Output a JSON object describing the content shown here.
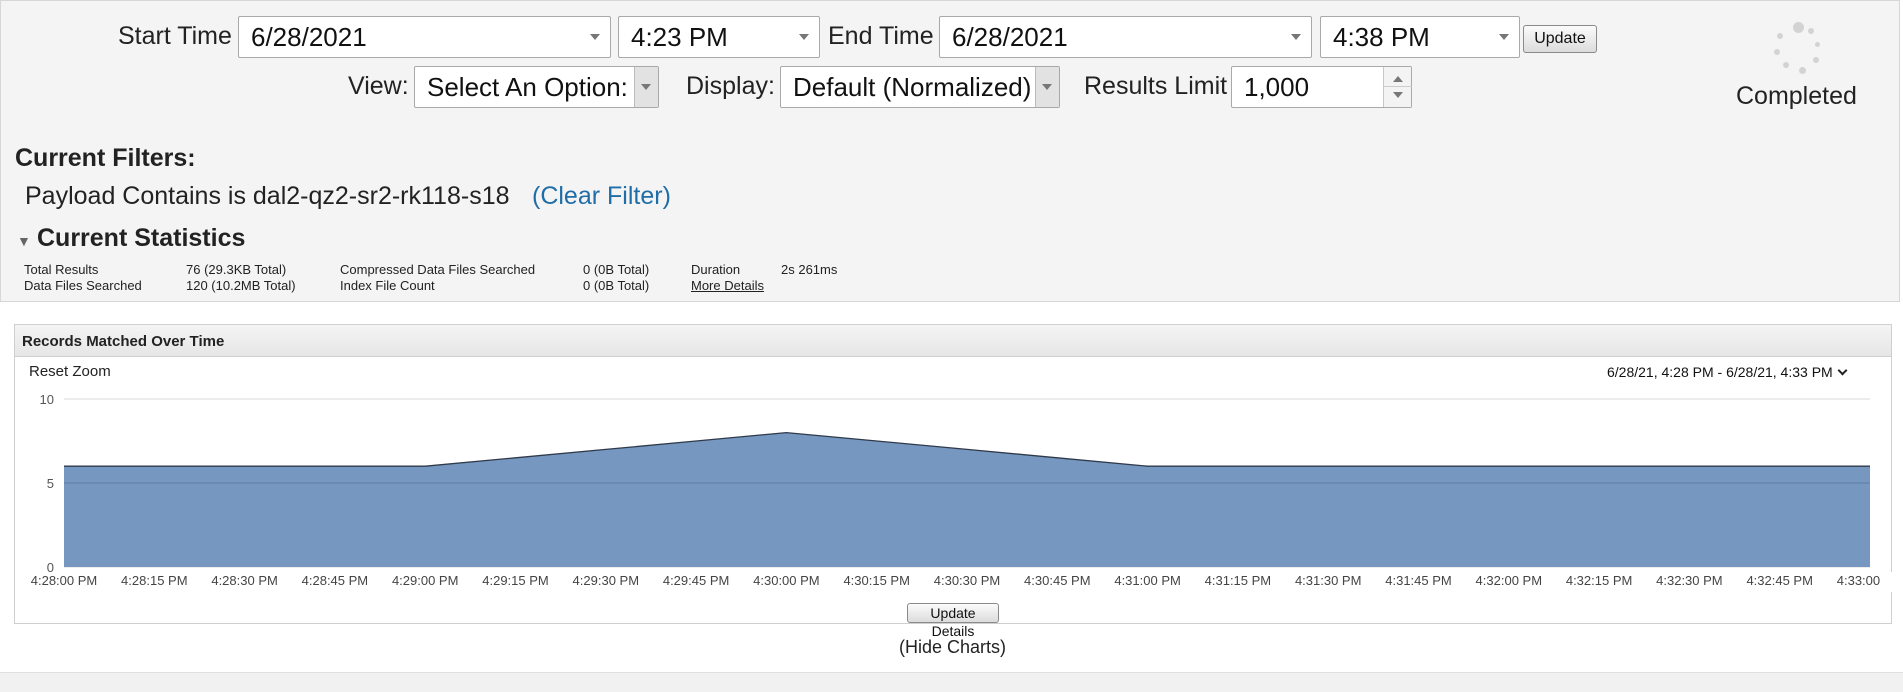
{
  "controls": {
    "start_time_label": "Start Time",
    "start_date": "6/28/2021",
    "start_time": "4:23 PM",
    "end_time_label": "End Time",
    "end_date": "6/28/2021",
    "end_time": "4:38 PM",
    "update_label": "Update",
    "view_label": "View:",
    "view_value": "Select An Option:",
    "display_label": "Display:",
    "display_value": "Default (Normalized)",
    "results_limit_label": "Results Limit",
    "results_limit_value": "1,000"
  },
  "status": {
    "text": "Completed",
    "icon": "loading-spinner-icon"
  },
  "filters": {
    "title": "Current Filters:",
    "items": [
      "Payload Contains is dal2-qz2-sr2-rk118-s18"
    ],
    "clear_label": "(Clear Filter)"
  },
  "statistics": {
    "title": "Current Statistics",
    "toggle_icon": "triangle-down-icon",
    "rows": [
      [
        {
          "label": "Total Results",
          "value": "76 (29.3KB Total)"
        },
        {
          "label": "Compressed Data Files Searched",
          "value": "0 (0B Total)"
        },
        {
          "label": "Duration",
          "value": "2s 261ms"
        }
      ],
      [
        {
          "label": "Data Files Searched",
          "value": "120 (10.2MB Total)"
        },
        {
          "label": "Index File Count",
          "value": "0 (0B Total)"
        },
        {
          "label": "More Details",
          "value": ""
        }
      ]
    ]
  },
  "chart_panel": {
    "title": "Records Matched Over Time",
    "reset_zoom": "Reset Zoom",
    "range": "6/28/21, 4:28 PM - 6/28/21, 4:33 PM",
    "update_details": "Update Details"
  },
  "hide_charts": "(Hide Charts)",
  "colors": {
    "area_fill": "#7597c0",
    "area_line": "#2f3a4a",
    "link": "#1f6ea8"
  },
  "chart_data": {
    "type": "area",
    "title": "",
    "xlabel": "",
    "ylabel": "",
    "x": [
      "4:28:00 PM",
      "4:28:15 PM",
      "4:28:30 PM",
      "4:28:45 PM",
      "4:29:00 PM",
      "4:29:15 PM",
      "4:29:30 PM",
      "4:29:45 PM",
      "4:30:00 PM",
      "4:30:15 PM",
      "4:30:30 PM",
      "4:30:45 PM",
      "4:31:00 PM",
      "4:31:15 PM",
      "4:31:30 PM",
      "4:31:45 PM",
      "4:32:00 PM",
      "4:32:15 PM",
      "4:32:30 PM",
      "4:32:45 PM",
      "4:33:00 PM"
    ],
    "series": [
      {
        "values": [
          6,
          6,
          6,
          6,
          6,
          null,
          null,
          null,
          8,
          null,
          null,
          null,
          6,
          6,
          6,
          6,
          6,
          6,
          6,
          6,
          6
        ]
      }
    ],
    "yticks": [
      0,
      5,
      10
    ],
    "ylim": [
      0,
      10
    ],
    "grid": true,
    "legend": "none"
  }
}
